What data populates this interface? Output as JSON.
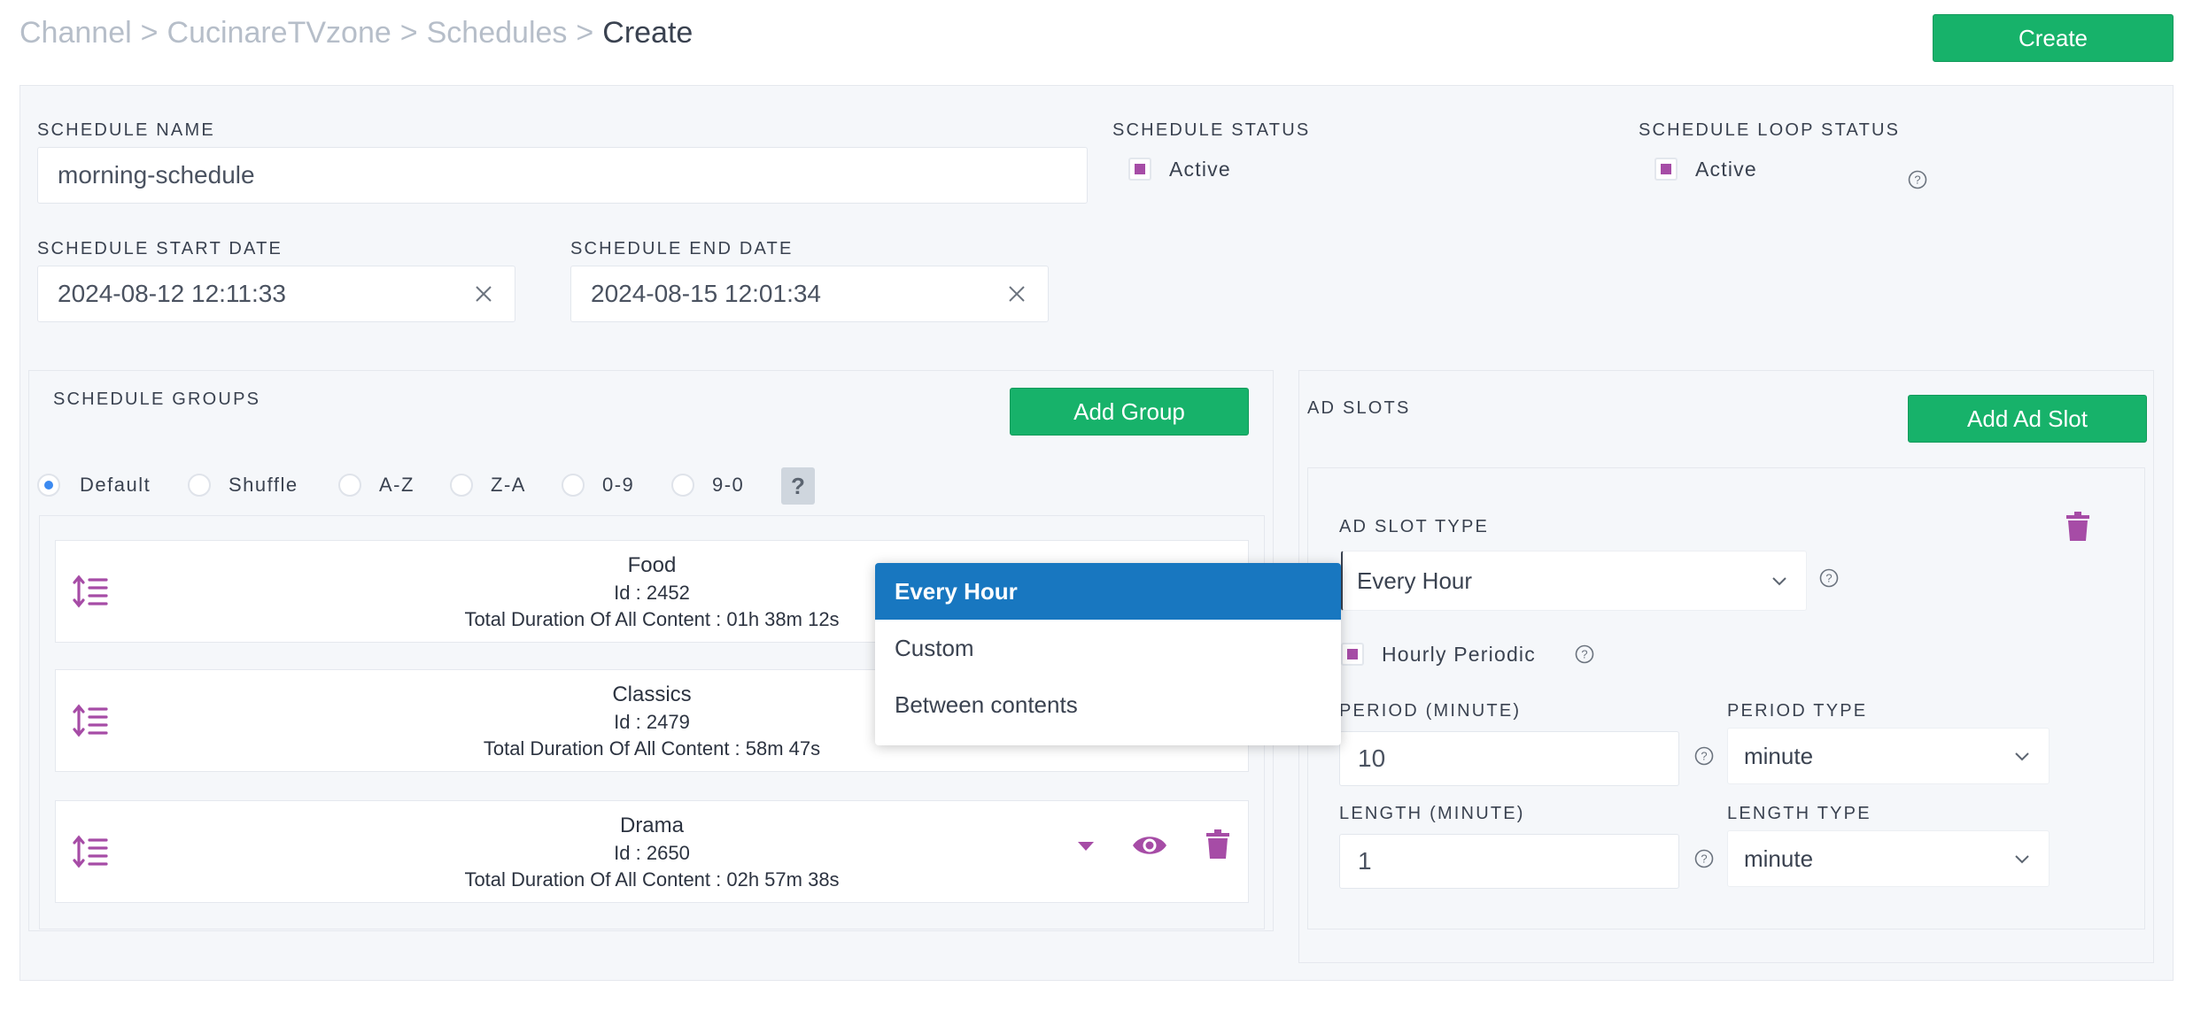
{
  "breadcrumb": {
    "items": [
      "Channel",
      "CucinareTVzone",
      "Schedules"
    ],
    "current": "Create",
    "separator": ">"
  },
  "header": {
    "create_label": "Create"
  },
  "schedule": {
    "name_label": "SCHEDULE NAME",
    "name_value": "morning-schedule",
    "status_label": "SCHEDULE STATUS",
    "status_value": "Active",
    "loop_label": "SCHEDULE LOOP STATUS",
    "loop_value": "Active",
    "start_label": "SCHEDULE START DATE",
    "start_value": "2024-08-12 12:11:33",
    "end_label": "SCHEDULE END DATE",
    "end_value": "2024-08-15 12:01:34"
  },
  "groups": {
    "title": "SCHEDULE GROUPS",
    "add_label": "Add Group",
    "sort_options": [
      "Default",
      "Shuffle",
      "A-Z",
      "Z-A",
      "0-9",
      "9-0"
    ],
    "sort_selected": "Default",
    "help_label": "?",
    "items": [
      {
        "title": "Food",
        "id": "Id : 2452",
        "duration": "Total Duration Of All Content : 01h 38m 12s"
      },
      {
        "title": "Classics",
        "id": "Id : 2479",
        "duration": "Total Duration Of All Content : 58m 47s"
      },
      {
        "title": "Drama",
        "id": "Id : 2650",
        "duration": "Total Duration Of All Content : 02h 57m 38s"
      }
    ]
  },
  "adslots": {
    "title": "AD SLOTS",
    "add_label": "Add Ad Slot",
    "type_label": "AD SLOT TYPE",
    "type_value": "Every Hour",
    "hourly_label": "Hourly Periodic",
    "period_label": "PERIOD (MINUTE)",
    "period_value": "10",
    "period_type_label": "PERIOD TYPE",
    "period_type_value": "minute",
    "length_label": "LENGTH (MINUTE)",
    "length_value": "1",
    "length_type_label": "LENGTH TYPE",
    "length_type_value": "minute"
  },
  "dropdown": {
    "options": [
      "Every Hour",
      "Custom",
      "Between contents"
    ],
    "selected": "Every Hour"
  },
  "colors": {
    "green": "#17b26a",
    "purple": "#a64ca6",
    "blue_selected": "#1877c0"
  }
}
